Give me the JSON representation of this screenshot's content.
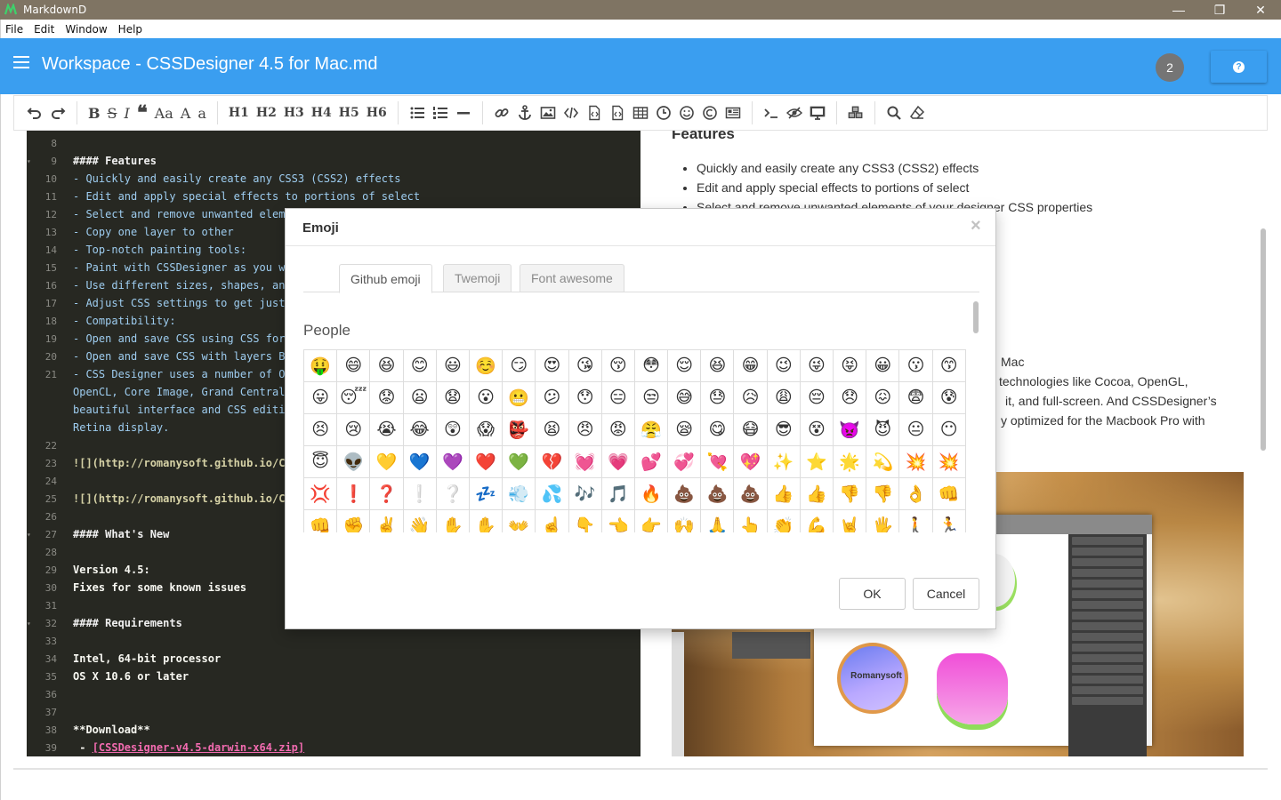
{
  "window": {
    "title": "MarkdownD",
    "min": "—",
    "restore": "❐",
    "close": "✕"
  },
  "menu": [
    "File",
    "Edit",
    "Window",
    "Help"
  ],
  "header": {
    "title": "Workspace - CSSDesigner 4.5 for Mac.md",
    "badge_count": "2",
    "help_icon": "?"
  },
  "toolbar": {
    "bold": "B",
    "strike": "S",
    "italic": "I",
    "quote": "❝",
    "case": "Aa",
    "upper": "A",
    "lower": "a",
    "h1": "H1",
    "h2": "H2",
    "h3": "H3",
    "h4": "H4",
    "h5": "H5",
    "h6": "H6"
  },
  "editor": {
    "lines": [
      {
        "n": "8",
        "text": "",
        "cls": "",
        "fold": ""
      },
      {
        "n": "9",
        "text": "#### Features",
        "cls": "h",
        "fold": "▾"
      },
      {
        "n": "10",
        "text": "- Quickly and easily create any CSS3 (CSS2) effects",
        "cls": "li",
        "fold": ""
      },
      {
        "n": "11",
        "text": "- Edit and apply special effects to portions of select",
        "cls": "li",
        "fold": ""
      },
      {
        "n": "12",
        "text": "- Select and remove unwanted eleme",
        "cls": "li",
        "fold": ""
      },
      {
        "n": "13",
        "text": "- Copy one layer to other",
        "cls": "li",
        "fold": ""
      },
      {
        "n": "14",
        "text": "- Top-notch painting tools:",
        "cls": "li",
        "fold": ""
      },
      {
        "n": "15",
        "text": "- Paint with CSSDesigner as you wo",
        "cls": "li",
        "fold": ""
      },
      {
        "n": "16",
        "text": "- Use different sizes, shapes, and",
        "cls": "li",
        "fold": ""
      },
      {
        "n": "17",
        "text": "- Adjust CSS settings to get just",
        "cls": "li",
        "fold": ""
      },
      {
        "n": "18",
        "text": "- Compatibility:",
        "cls": "li",
        "fold": ""
      },
      {
        "n": "19",
        "text": "- Open and save CSS using CSS form",
        "cls": "li",
        "fold": ""
      },
      {
        "n": "20",
        "text": "- Open and save CSS with layers Bo",
        "cls": "li",
        "fold": ""
      },
      {
        "n": "21",
        "text": "- CSS Designer uses a number of OS",
        "cls": "li",
        "fold": ""
      },
      {
        "n": "",
        "text": "OpenCL, Core Image, Grand Central",
        "cls": "li",
        "fold": ""
      },
      {
        "n": "",
        "text": "beautiful interface and CSS editi",
        "cls": "li",
        "fold": ""
      },
      {
        "n": "",
        "text": "Retina display.",
        "cls": "li",
        "fold": ""
      },
      {
        "n": "22",
        "text": "",
        "cls": "",
        "fold": ""
      },
      {
        "n": "23",
        "text": "![](http://romanysoft.github.io/CS",
        "cls": "url",
        "fold": ""
      },
      {
        "n": "24",
        "text": "",
        "cls": "",
        "fold": ""
      },
      {
        "n": "25",
        "text": "![](http://romanysoft.github.io/CS",
        "cls": "url",
        "fold": ""
      },
      {
        "n": "26",
        "text": "",
        "cls": "",
        "fold": ""
      },
      {
        "n": "27",
        "text": "#### What's New",
        "cls": "h",
        "fold": "▾"
      },
      {
        "n": "28",
        "text": "",
        "cls": "",
        "fold": ""
      },
      {
        "n": "29",
        "text": "Version 4.5:",
        "cls": "str",
        "fold": ""
      },
      {
        "n": "30",
        "text": "Fixes for some known issues",
        "cls": "str",
        "fold": ""
      },
      {
        "n": "31",
        "text": "",
        "cls": "",
        "fold": ""
      },
      {
        "n": "32",
        "text": "#### Requirements",
        "cls": "h",
        "fold": "▾"
      },
      {
        "n": "33",
        "text": "",
        "cls": "",
        "fold": ""
      },
      {
        "n": "34",
        "text": "Intel, 64-bit processor",
        "cls": "str",
        "fold": ""
      },
      {
        "n": "35",
        "text": "OS X 10.6 or later",
        "cls": "str",
        "fold": ""
      },
      {
        "n": "36",
        "text": "",
        "cls": "",
        "fold": ""
      },
      {
        "n": "37",
        "text": "",
        "cls": "",
        "fold": ""
      },
      {
        "n": "38",
        "text": "**Download**",
        "cls": "str",
        "fold": ""
      },
      {
        "n": "39",
        "text": " - ",
        "cls": "str",
        "fold": "",
        "link": "[CSSDesigner-v4.5-darwin-x64.zip]"
      }
    ]
  },
  "preview": {
    "heading": "Features",
    "items": [
      "Quickly and easily create any CSS3 (CSS2) effects",
      "Edit and apply special effects to portions of select",
      "Select and remove unwanted elements of your designer CSS properties"
    ],
    "frag1": "Mac",
    "frag2": "technologies like Cocoa, OpenGL,",
    "frag3": "it, and full-screen. And CSSDesigner’s",
    "frag4": "y optimized for the Macbook Pro with",
    "shot_logo": "Romanysoft"
  },
  "modal": {
    "title": "Emoji",
    "close": "×",
    "tabs": [
      "Github emoji",
      "Twemoji",
      "Font awesome"
    ],
    "category": "People",
    "ok": "OK",
    "cancel": "Cancel",
    "emoji_rows": [
      [
        "🤑",
        "😄",
        "😆",
        "😊",
        "😃",
        "☺️",
        "😏",
        "😍",
        "😘",
        "😚",
        "😳",
        "😌",
        "😆",
        "😁",
        "😉",
        "😜",
        "😝",
        "😀",
        "😗",
        "😙"
      ],
      [
        "😛",
        "😴",
        "😟",
        "😦",
        "😧",
        "😮",
        "😬",
        "😕",
        "😯",
        "😑",
        "😒",
        "😅",
        "😓",
        "😥",
        "😩",
        "😔",
        "😞",
        "😖",
        "😨",
        "😰"
      ],
      [
        "😣",
        "😢",
        "😭",
        "😂",
        "😲",
        "😱",
        "👺",
        "😫",
        "😠",
        "😡",
        "😤",
        "😪",
        "😋",
        "😷",
        "😎",
        "😵",
        "👿",
        "😈",
        "😐",
        "😶"
      ],
      [
        "😇",
        "👽",
        "💛",
        "💙",
        "💜",
        "❤️",
        "💚",
        "💔",
        "💓",
        "💗",
        "💕",
        "💞",
        "💘",
        "💖",
        "✨",
        "⭐",
        "🌟",
        "💫",
        "💥",
        "💥"
      ],
      [
        "💢",
        "❗",
        "❓",
        "❕",
        "❔",
        "💤",
        "💨",
        "💦",
        "🎶",
        "🎵",
        "🔥",
        "💩",
        "💩",
        "💩",
        "👍",
        "👍",
        "👎",
        "👎",
        "👌",
        "👊"
      ],
      [
        "👊",
        "✊",
        "✌️",
        "👋",
        "✋",
        "✋",
        "👐",
        "☝️",
        "👇",
        "👈",
        "👉",
        "🙌",
        "🙏",
        "👆",
        "👏",
        "💪",
        "🤘",
        "🖐",
        "🚶",
        "🏃"
      ]
    ]
  }
}
